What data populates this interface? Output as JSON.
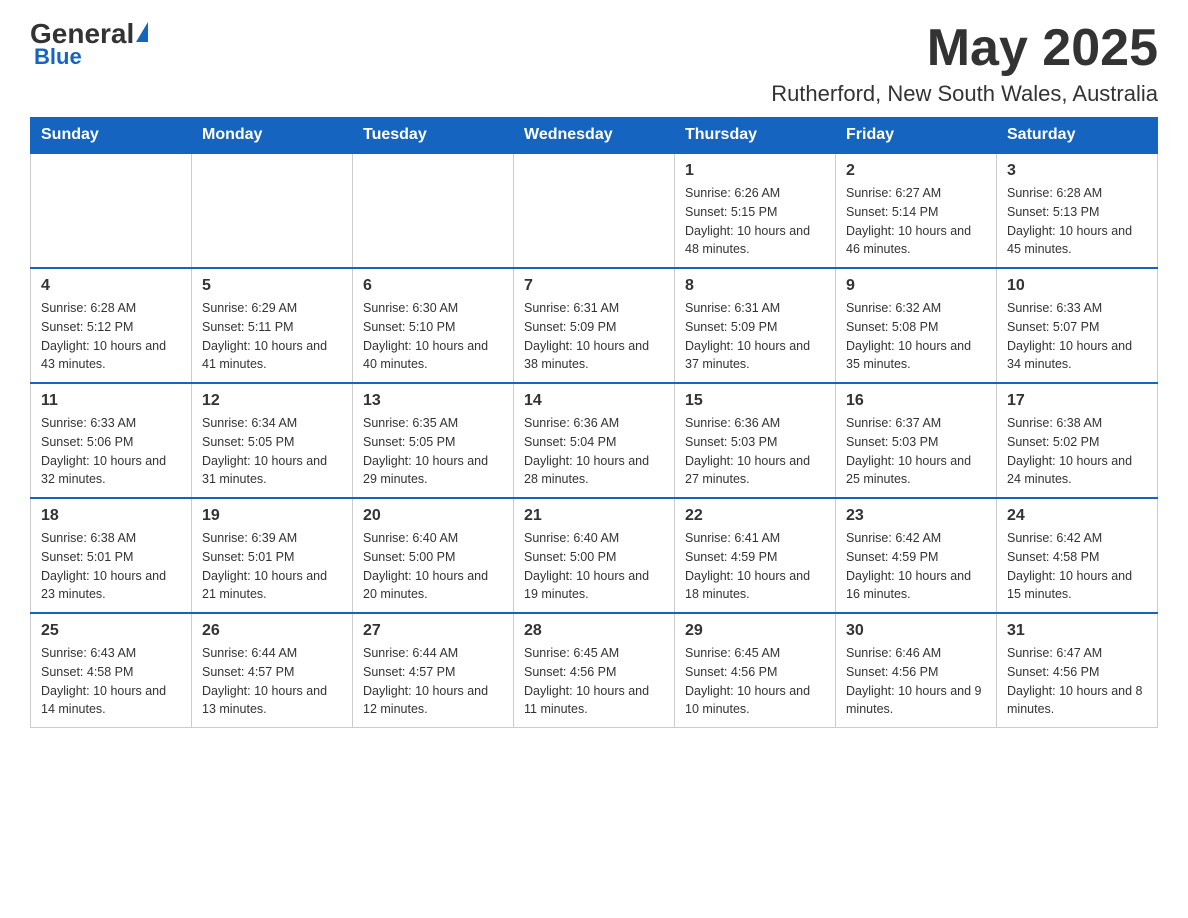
{
  "header": {
    "logo_general": "General",
    "logo_blue": "Blue",
    "month_year": "May 2025",
    "location": "Rutherford, New South Wales, Australia"
  },
  "days_of_week": [
    "Sunday",
    "Monday",
    "Tuesday",
    "Wednesday",
    "Thursday",
    "Friday",
    "Saturday"
  ],
  "weeks": [
    [
      {
        "day": "",
        "info": ""
      },
      {
        "day": "",
        "info": ""
      },
      {
        "day": "",
        "info": ""
      },
      {
        "day": "",
        "info": ""
      },
      {
        "day": "1",
        "info": "Sunrise: 6:26 AM\nSunset: 5:15 PM\nDaylight: 10 hours and 48 minutes."
      },
      {
        "day": "2",
        "info": "Sunrise: 6:27 AM\nSunset: 5:14 PM\nDaylight: 10 hours and 46 minutes."
      },
      {
        "day": "3",
        "info": "Sunrise: 6:28 AM\nSunset: 5:13 PM\nDaylight: 10 hours and 45 minutes."
      }
    ],
    [
      {
        "day": "4",
        "info": "Sunrise: 6:28 AM\nSunset: 5:12 PM\nDaylight: 10 hours and 43 minutes."
      },
      {
        "day": "5",
        "info": "Sunrise: 6:29 AM\nSunset: 5:11 PM\nDaylight: 10 hours and 41 minutes."
      },
      {
        "day": "6",
        "info": "Sunrise: 6:30 AM\nSunset: 5:10 PM\nDaylight: 10 hours and 40 minutes."
      },
      {
        "day": "7",
        "info": "Sunrise: 6:31 AM\nSunset: 5:09 PM\nDaylight: 10 hours and 38 minutes."
      },
      {
        "day": "8",
        "info": "Sunrise: 6:31 AM\nSunset: 5:09 PM\nDaylight: 10 hours and 37 minutes."
      },
      {
        "day": "9",
        "info": "Sunrise: 6:32 AM\nSunset: 5:08 PM\nDaylight: 10 hours and 35 minutes."
      },
      {
        "day": "10",
        "info": "Sunrise: 6:33 AM\nSunset: 5:07 PM\nDaylight: 10 hours and 34 minutes."
      }
    ],
    [
      {
        "day": "11",
        "info": "Sunrise: 6:33 AM\nSunset: 5:06 PM\nDaylight: 10 hours and 32 minutes."
      },
      {
        "day": "12",
        "info": "Sunrise: 6:34 AM\nSunset: 5:05 PM\nDaylight: 10 hours and 31 minutes."
      },
      {
        "day": "13",
        "info": "Sunrise: 6:35 AM\nSunset: 5:05 PM\nDaylight: 10 hours and 29 minutes."
      },
      {
        "day": "14",
        "info": "Sunrise: 6:36 AM\nSunset: 5:04 PM\nDaylight: 10 hours and 28 minutes."
      },
      {
        "day": "15",
        "info": "Sunrise: 6:36 AM\nSunset: 5:03 PM\nDaylight: 10 hours and 27 minutes."
      },
      {
        "day": "16",
        "info": "Sunrise: 6:37 AM\nSunset: 5:03 PM\nDaylight: 10 hours and 25 minutes."
      },
      {
        "day": "17",
        "info": "Sunrise: 6:38 AM\nSunset: 5:02 PM\nDaylight: 10 hours and 24 minutes."
      }
    ],
    [
      {
        "day": "18",
        "info": "Sunrise: 6:38 AM\nSunset: 5:01 PM\nDaylight: 10 hours and 23 minutes."
      },
      {
        "day": "19",
        "info": "Sunrise: 6:39 AM\nSunset: 5:01 PM\nDaylight: 10 hours and 21 minutes."
      },
      {
        "day": "20",
        "info": "Sunrise: 6:40 AM\nSunset: 5:00 PM\nDaylight: 10 hours and 20 minutes."
      },
      {
        "day": "21",
        "info": "Sunrise: 6:40 AM\nSunset: 5:00 PM\nDaylight: 10 hours and 19 minutes."
      },
      {
        "day": "22",
        "info": "Sunrise: 6:41 AM\nSunset: 4:59 PM\nDaylight: 10 hours and 18 minutes."
      },
      {
        "day": "23",
        "info": "Sunrise: 6:42 AM\nSunset: 4:59 PM\nDaylight: 10 hours and 16 minutes."
      },
      {
        "day": "24",
        "info": "Sunrise: 6:42 AM\nSunset: 4:58 PM\nDaylight: 10 hours and 15 minutes."
      }
    ],
    [
      {
        "day": "25",
        "info": "Sunrise: 6:43 AM\nSunset: 4:58 PM\nDaylight: 10 hours and 14 minutes."
      },
      {
        "day": "26",
        "info": "Sunrise: 6:44 AM\nSunset: 4:57 PM\nDaylight: 10 hours and 13 minutes."
      },
      {
        "day": "27",
        "info": "Sunrise: 6:44 AM\nSunset: 4:57 PM\nDaylight: 10 hours and 12 minutes."
      },
      {
        "day": "28",
        "info": "Sunrise: 6:45 AM\nSunset: 4:56 PM\nDaylight: 10 hours and 11 minutes."
      },
      {
        "day": "29",
        "info": "Sunrise: 6:45 AM\nSunset: 4:56 PM\nDaylight: 10 hours and 10 minutes."
      },
      {
        "day": "30",
        "info": "Sunrise: 6:46 AM\nSunset: 4:56 PM\nDaylight: 10 hours and 9 minutes."
      },
      {
        "day": "31",
        "info": "Sunrise: 6:47 AM\nSunset: 4:56 PM\nDaylight: 10 hours and 8 minutes."
      }
    ]
  ]
}
